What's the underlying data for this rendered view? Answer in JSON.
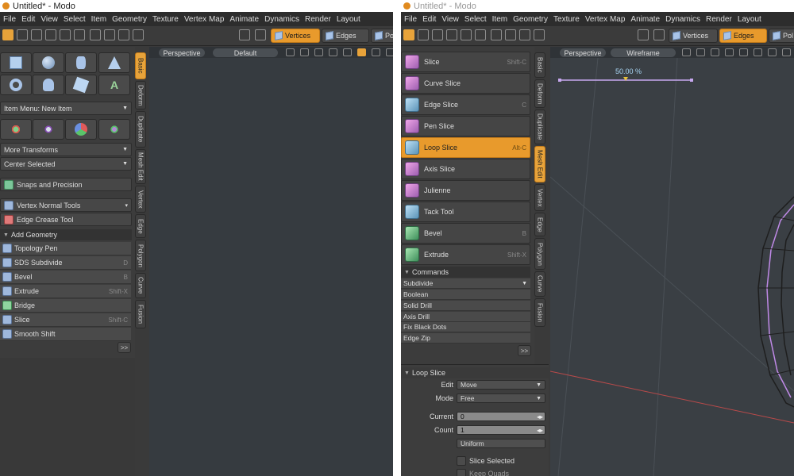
{
  "left": {
    "title": "Untitled* - Modo",
    "menu": [
      "File",
      "Edit",
      "View",
      "Select",
      "Item",
      "Geometry",
      "Texture",
      "Vertex Map",
      "Animate",
      "Dynamics",
      "Render",
      "Layout"
    ],
    "mode_buttons": {
      "vertices": "Vertices",
      "edges": "Edges",
      "polygons": "Po"
    },
    "viewport": {
      "view": "Perspective",
      "shading": "Default"
    },
    "item_menu": "Item Menu: New Item",
    "more_transforms": "More Transforms",
    "center_selected": "Center Selected",
    "snaps": "Snaps and Precision",
    "vertex_normal": "Vertex Normal Tools",
    "edge_crease": "Edge Crease Tool",
    "add_geometry": "Add Geometry",
    "tools": [
      {
        "label": "Topology Pen",
        "shortcut": ""
      },
      {
        "label": "SDS Subdivide",
        "shortcut": "D"
      },
      {
        "label": "Bevel",
        "shortcut": "B"
      },
      {
        "label": "Extrude",
        "shortcut": "Shift-X"
      },
      {
        "label": "Bridge",
        "shortcut": ""
      },
      {
        "label": "Slice",
        "shortcut": "Shift-C"
      },
      {
        "label": "Smooth Shift",
        "shortcut": ""
      }
    ],
    "more": ">>",
    "tabs": [
      "Basic",
      "Deform",
      "Duplicate",
      "Mesh Edit",
      "Vertex",
      "Edge",
      "Polygon",
      "Curve",
      "Fusion"
    ]
  },
  "right": {
    "title": "Untitled* - Modo",
    "menu": [
      "File",
      "Edit",
      "View",
      "Select",
      "Item",
      "Geometry",
      "Texture",
      "Vertex Map",
      "Animate",
      "Dynamics",
      "Render",
      "Layout"
    ],
    "mode_buttons": {
      "vertices": "Vertices",
      "edges": "Edges",
      "polygons": "Pol"
    },
    "viewport": {
      "view": "Perspective",
      "shading": "Wireframe",
      "percent": "50.00 %"
    },
    "tools": [
      {
        "label": "Slice",
        "shortcut": "Shift-C"
      },
      {
        "label": "Curve Slice",
        "shortcut": ""
      },
      {
        "label": "Edge Slice",
        "shortcut": "C"
      },
      {
        "label": "Pen Slice",
        "shortcut": ""
      },
      {
        "label": "Loop Slice",
        "shortcut": "Alt-C"
      },
      {
        "label": "Axis Slice",
        "shortcut": ""
      },
      {
        "label": "Julienne",
        "shortcut": ""
      },
      {
        "label": "Tack Tool",
        "shortcut": ""
      },
      {
        "label": "Bevel",
        "shortcut": "B"
      },
      {
        "label": "Extrude",
        "shortcut": "Shift-X"
      }
    ],
    "commands_header": "Commands",
    "commands": [
      "Subdivide",
      "Boolean",
      "Solid Drill",
      "Axis Drill",
      "Fix Black Dots",
      "Edge Zip"
    ],
    "more": ">>",
    "tabs": [
      "Basic",
      "Deform",
      "Duplicate",
      "Mesh Edit",
      "Vertex",
      "Edge",
      "Polygon",
      "Curve",
      "Fusion"
    ],
    "props": {
      "header": "Loop Slice",
      "edit_label": "Edit",
      "edit_value": "Move",
      "mode_label": "Mode",
      "mode_value": "Free",
      "current_label": "Current",
      "current_value": "0",
      "count_label": "Count",
      "count_value": "1",
      "uniform": "Uniform",
      "slice_selected": "Slice Selected",
      "keep_quads": "Keep Quads"
    }
  }
}
